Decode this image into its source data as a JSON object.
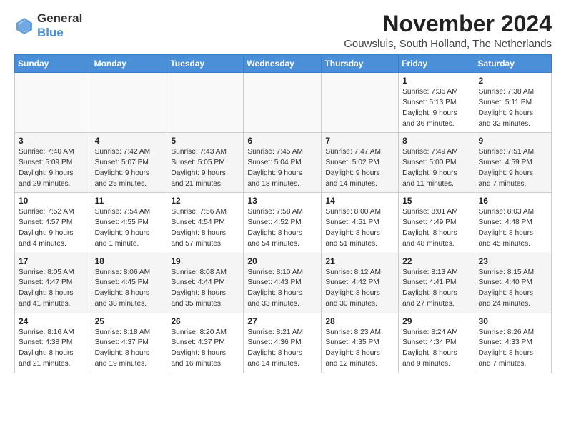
{
  "logo": {
    "line1": "General",
    "line2": "Blue"
  },
  "title": "November 2024",
  "subtitle": "Gouwsluis, South Holland, The Netherlands",
  "days_header": [
    "Sunday",
    "Monday",
    "Tuesday",
    "Wednesday",
    "Thursday",
    "Friday",
    "Saturday"
  ],
  "weeks": [
    [
      {
        "day": "",
        "detail": ""
      },
      {
        "day": "",
        "detail": ""
      },
      {
        "day": "",
        "detail": ""
      },
      {
        "day": "",
        "detail": ""
      },
      {
        "day": "",
        "detail": ""
      },
      {
        "day": "1",
        "detail": "Sunrise: 7:36 AM\nSunset: 5:13 PM\nDaylight: 9 hours\nand 36 minutes."
      },
      {
        "day": "2",
        "detail": "Sunrise: 7:38 AM\nSunset: 5:11 PM\nDaylight: 9 hours\nand 32 minutes."
      }
    ],
    [
      {
        "day": "3",
        "detail": "Sunrise: 7:40 AM\nSunset: 5:09 PM\nDaylight: 9 hours\nand 29 minutes."
      },
      {
        "day": "4",
        "detail": "Sunrise: 7:42 AM\nSunset: 5:07 PM\nDaylight: 9 hours\nand 25 minutes."
      },
      {
        "day": "5",
        "detail": "Sunrise: 7:43 AM\nSunset: 5:05 PM\nDaylight: 9 hours\nand 21 minutes."
      },
      {
        "day": "6",
        "detail": "Sunrise: 7:45 AM\nSunset: 5:04 PM\nDaylight: 9 hours\nand 18 minutes."
      },
      {
        "day": "7",
        "detail": "Sunrise: 7:47 AM\nSunset: 5:02 PM\nDaylight: 9 hours\nand 14 minutes."
      },
      {
        "day": "8",
        "detail": "Sunrise: 7:49 AM\nSunset: 5:00 PM\nDaylight: 9 hours\nand 11 minutes."
      },
      {
        "day": "9",
        "detail": "Sunrise: 7:51 AM\nSunset: 4:59 PM\nDaylight: 9 hours\nand 7 minutes."
      }
    ],
    [
      {
        "day": "10",
        "detail": "Sunrise: 7:52 AM\nSunset: 4:57 PM\nDaylight: 9 hours\nand 4 minutes."
      },
      {
        "day": "11",
        "detail": "Sunrise: 7:54 AM\nSunset: 4:55 PM\nDaylight: 9 hours\nand 1 minute."
      },
      {
        "day": "12",
        "detail": "Sunrise: 7:56 AM\nSunset: 4:54 PM\nDaylight: 8 hours\nand 57 minutes."
      },
      {
        "day": "13",
        "detail": "Sunrise: 7:58 AM\nSunset: 4:52 PM\nDaylight: 8 hours\nand 54 minutes."
      },
      {
        "day": "14",
        "detail": "Sunrise: 8:00 AM\nSunset: 4:51 PM\nDaylight: 8 hours\nand 51 minutes."
      },
      {
        "day": "15",
        "detail": "Sunrise: 8:01 AM\nSunset: 4:49 PM\nDaylight: 8 hours\nand 48 minutes."
      },
      {
        "day": "16",
        "detail": "Sunrise: 8:03 AM\nSunset: 4:48 PM\nDaylight: 8 hours\nand 45 minutes."
      }
    ],
    [
      {
        "day": "17",
        "detail": "Sunrise: 8:05 AM\nSunset: 4:47 PM\nDaylight: 8 hours\nand 41 minutes."
      },
      {
        "day": "18",
        "detail": "Sunrise: 8:06 AM\nSunset: 4:45 PM\nDaylight: 8 hours\nand 38 minutes."
      },
      {
        "day": "19",
        "detail": "Sunrise: 8:08 AM\nSunset: 4:44 PM\nDaylight: 8 hours\nand 35 minutes."
      },
      {
        "day": "20",
        "detail": "Sunrise: 8:10 AM\nSunset: 4:43 PM\nDaylight: 8 hours\nand 33 minutes."
      },
      {
        "day": "21",
        "detail": "Sunrise: 8:12 AM\nSunset: 4:42 PM\nDaylight: 8 hours\nand 30 minutes."
      },
      {
        "day": "22",
        "detail": "Sunrise: 8:13 AM\nSunset: 4:41 PM\nDaylight: 8 hours\nand 27 minutes."
      },
      {
        "day": "23",
        "detail": "Sunrise: 8:15 AM\nSunset: 4:40 PM\nDaylight: 8 hours\nand 24 minutes."
      }
    ],
    [
      {
        "day": "24",
        "detail": "Sunrise: 8:16 AM\nSunset: 4:38 PM\nDaylight: 8 hours\nand 21 minutes."
      },
      {
        "day": "25",
        "detail": "Sunrise: 8:18 AM\nSunset: 4:37 PM\nDaylight: 8 hours\nand 19 minutes."
      },
      {
        "day": "26",
        "detail": "Sunrise: 8:20 AM\nSunset: 4:37 PM\nDaylight: 8 hours\nand 16 minutes."
      },
      {
        "day": "27",
        "detail": "Sunrise: 8:21 AM\nSunset: 4:36 PM\nDaylight: 8 hours\nand 14 minutes."
      },
      {
        "day": "28",
        "detail": "Sunrise: 8:23 AM\nSunset: 4:35 PM\nDaylight: 8 hours\nand 12 minutes."
      },
      {
        "day": "29",
        "detail": "Sunrise: 8:24 AM\nSunset: 4:34 PM\nDaylight: 8 hours\nand 9 minutes."
      },
      {
        "day": "30",
        "detail": "Sunrise: 8:26 AM\nSunset: 4:33 PM\nDaylight: 8 hours\nand 7 minutes."
      }
    ]
  ]
}
